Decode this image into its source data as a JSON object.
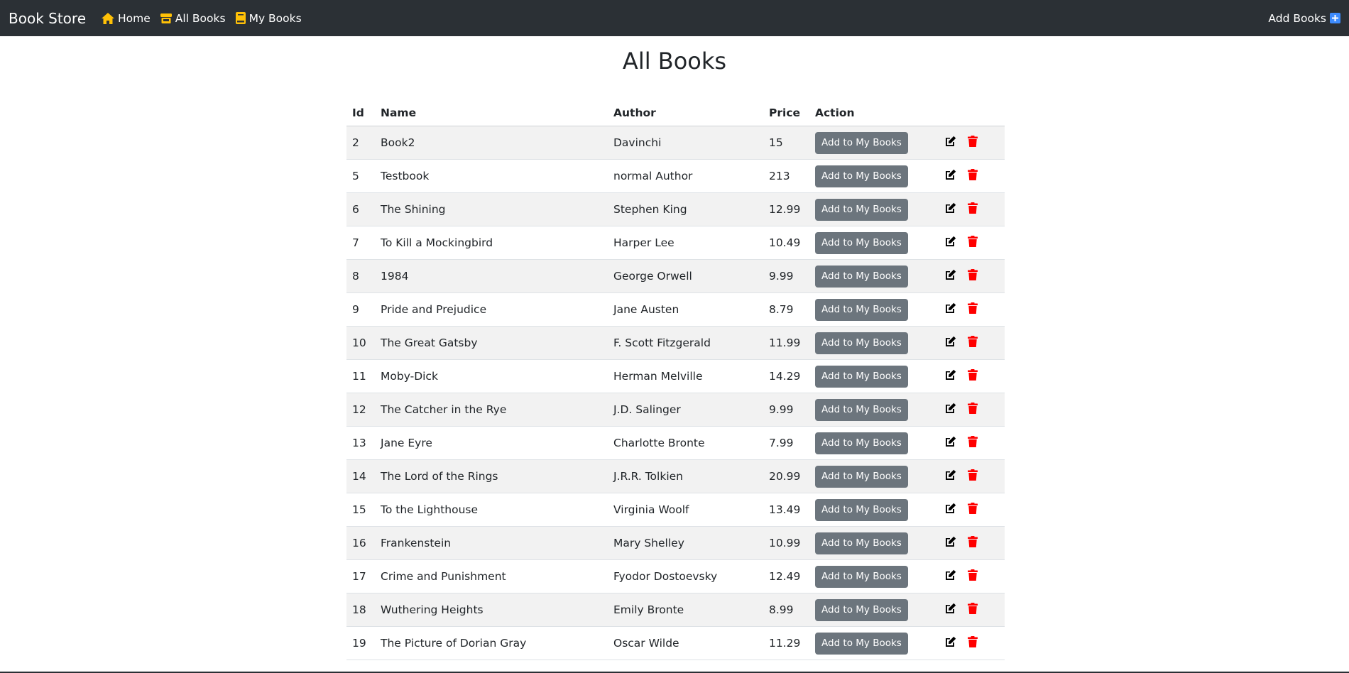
{
  "navbar": {
    "brand": "Book Store",
    "links": [
      {
        "label": "Home",
        "icon": "home-icon"
      },
      {
        "label": "All Books",
        "icon": "shop-icon"
      },
      {
        "label": "My Books",
        "icon": "book-icon"
      }
    ],
    "add_books_label": "Add Books"
  },
  "page": {
    "title": "All Books"
  },
  "table": {
    "headers": {
      "id": "Id",
      "name": "Name",
      "author": "Author",
      "price": "Price",
      "action": "Action"
    },
    "add_button_label": "Add to My Books",
    "rows": [
      {
        "id": "2",
        "name": "Book2",
        "author": "Davinchi",
        "price": "15"
      },
      {
        "id": "5",
        "name": "Testbook",
        "author": "normal Author",
        "price": "213"
      },
      {
        "id": "6",
        "name": "The Shining",
        "author": "Stephen King",
        "price": "12.99"
      },
      {
        "id": "7",
        "name": "To Kill a Mockingbird",
        "author": "Harper Lee",
        "price": "10.49"
      },
      {
        "id": "8",
        "name": "1984",
        "author": "George Orwell",
        "price": "9.99"
      },
      {
        "id": "9",
        "name": "Pride and Prejudice",
        "author": "Jane Austen",
        "price": "8.79"
      },
      {
        "id": "10",
        "name": "The Great Gatsby",
        "author": "F. Scott Fitzgerald",
        "price": "11.99"
      },
      {
        "id": "11",
        "name": "Moby-Dick",
        "author": "Herman Melville",
        "price": "14.29"
      },
      {
        "id": "12",
        "name": "The Catcher in the Rye",
        "author": "J.D. Salinger",
        "price": "9.99"
      },
      {
        "id": "13",
        "name": "Jane Eyre",
        "author": "Charlotte Bronte",
        "price": "7.99"
      },
      {
        "id": "14",
        "name": "The Lord of the Rings",
        "author": "J.R.R. Tolkien",
        "price": "20.99"
      },
      {
        "id": "15",
        "name": "To the Lighthouse",
        "author": "Virginia Woolf",
        "price": "13.49"
      },
      {
        "id": "16",
        "name": "Frankenstein",
        "author": "Mary Shelley",
        "price": "10.99"
      },
      {
        "id": "17",
        "name": "Crime and Punishment",
        "author": "Fyodor Dostoevsky",
        "price": "12.49"
      },
      {
        "id": "18",
        "name": "Wuthering Heights",
        "author": "Emily Bronte",
        "price": "8.99"
      },
      {
        "id": "19",
        "name": "The Picture of Dorian Gray",
        "author": "Oscar Wilde",
        "price": "11.29"
      }
    ]
  },
  "colors": {
    "navbar_bg": "#2b3035",
    "nav_icon": "#ffc107",
    "add_icon": "#0d6efd",
    "button_bg": "#6c757d",
    "delete_icon": "#ff0000",
    "stripe": "#f2f2f2"
  }
}
